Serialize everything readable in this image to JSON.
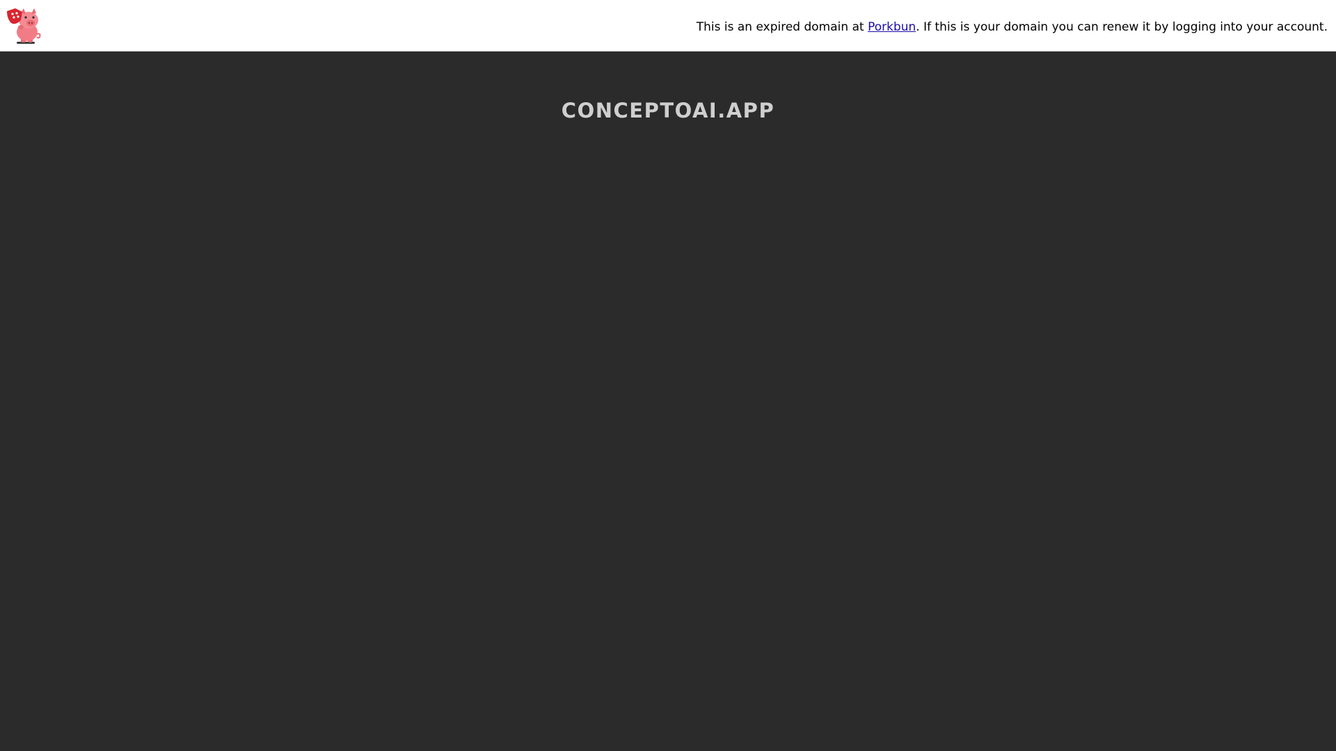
{
  "header": {
    "logo_icon": "porkbun-pig-mascot-icon",
    "notice": {
      "prefix": "This is an expired domain at ",
      "link_label": "Porkbun",
      "suffix": ". If this is your domain you can renew it by logging into your account."
    }
  },
  "main": {
    "domain_name": "CONCEPTOAI.APP"
  },
  "colors": {
    "header_bg": "#ffffff",
    "main_bg": "#2b2b2b",
    "title_text": "#cfcfcf",
    "link": "#1a0dab",
    "brand_pink": "#f27c85"
  }
}
